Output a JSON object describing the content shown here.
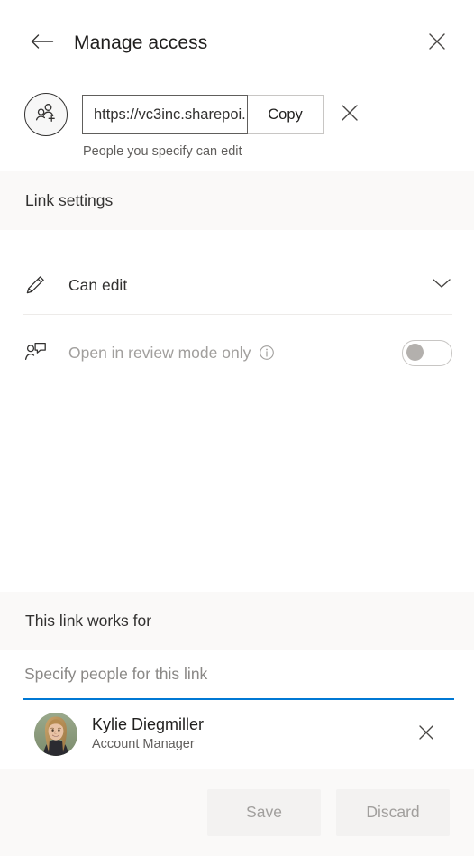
{
  "header": {
    "title": "Manage access",
    "back_icon": "arrow-left-icon",
    "close_icon": "close-icon"
  },
  "link": {
    "badge_icon": "people-add-icon",
    "url_value": "https://vc3inc.sharepoi...",
    "url_placeholder": "",
    "copy_label": "Copy",
    "remove_icon": "close-icon",
    "subtext": "People you specify can edit"
  },
  "link_settings": {
    "band_title": "Link settings",
    "permission": {
      "icon": "pencil-icon",
      "label": "Can edit",
      "chevron_icon": "chevron-down-icon"
    },
    "review_mode": {
      "icon": "person-comment-icon",
      "label": "Open in review mode only",
      "info_icon": "info-icon",
      "toggle_state": "off"
    }
  },
  "works_for": {
    "band_title": "This link works for",
    "picker_placeholder": "Specify people for this link",
    "picker_value": "",
    "people": [
      {
        "name": "Kylie Diegmiller",
        "role": "Account Manager",
        "avatar": "user-photo",
        "remove_icon": "close-icon"
      }
    ]
  },
  "footer": {
    "save_label": "Save",
    "discard_label": "Discard"
  },
  "colors": {
    "accent": "#0078d4",
    "band_bg": "#faf9f8",
    "text_primary": "#323130",
    "text_muted": "#605e5c",
    "disabled_text": "#a19f9d"
  }
}
